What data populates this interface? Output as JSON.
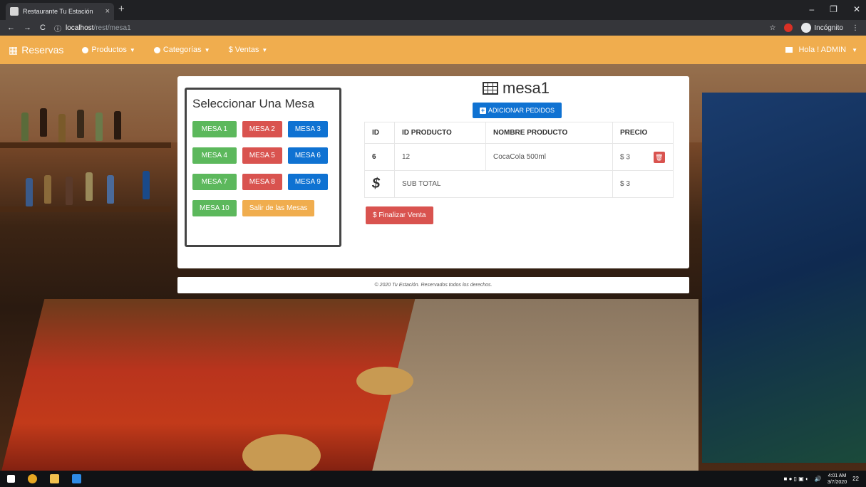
{
  "browser": {
    "tab_title": "Restaurante Tu Estación",
    "tab_close": "×",
    "new_tab": "+",
    "url_host": "localhost",
    "url_path": "/rest/mesa1",
    "incognito_label": "Incógnito"
  },
  "navbar": {
    "brand": "Reservas",
    "items": [
      {
        "label": "Productos",
        "icon": "circle-icon"
      },
      {
        "label": "Categorías",
        "icon": "circle-icon"
      },
      {
        "label": "$ Ventas",
        "icon": "dollar-icon"
      }
    ],
    "user_label": "Hola ! ADMIN",
    "background": "#f0ad4e"
  },
  "mesas_panel": {
    "title": "Seleccionar Una Mesa",
    "buttons": [
      {
        "label": "MESA 1",
        "color": "green"
      },
      {
        "label": "MESA 2",
        "color": "red"
      },
      {
        "label": "MESA 3",
        "color": "blue"
      },
      {
        "label": "MESA 4",
        "color": "green"
      },
      {
        "label": "MESA 5",
        "color": "red"
      },
      {
        "label": "MESA 6",
        "color": "blue"
      },
      {
        "label": "MESA 7",
        "color": "green"
      },
      {
        "label": "MESA 8",
        "color": "red"
      },
      {
        "label": "MESA 9",
        "color": "blue"
      },
      {
        "label": "MESA 10",
        "color": "green"
      },
      {
        "label": "Salir de las Mesas",
        "color": "orange"
      }
    ]
  },
  "order": {
    "title": "mesa1",
    "add_button": "ADICIONAR PEDIDOS",
    "headers": [
      "ID",
      "ID PRODUCTO",
      "NOMBRE PRODUCTO",
      "PRECIO"
    ],
    "rows": [
      {
        "id": "6",
        "product_id": "12",
        "product_name": "CocaCola 500ml",
        "price": "$ 3"
      }
    ],
    "subtotal_label": "SUB TOTAL",
    "subtotal_value": "$ 3",
    "finalize_button": "$ Finalizar Venta"
  },
  "footer": {
    "text": "© 2020 Tu Estación. Reservados todos los derechos."
  },
  "taskbar": {
    "time": "4:01 AM",
    "date": "3/7/2020",
    "notifications": "22"
  },
  "colors": {
    "green": "#5cb85c",
    "red": "#d9534f",
    "blue": "#0f72d2",
    "orange": "#f0ad4e"
  }
}
